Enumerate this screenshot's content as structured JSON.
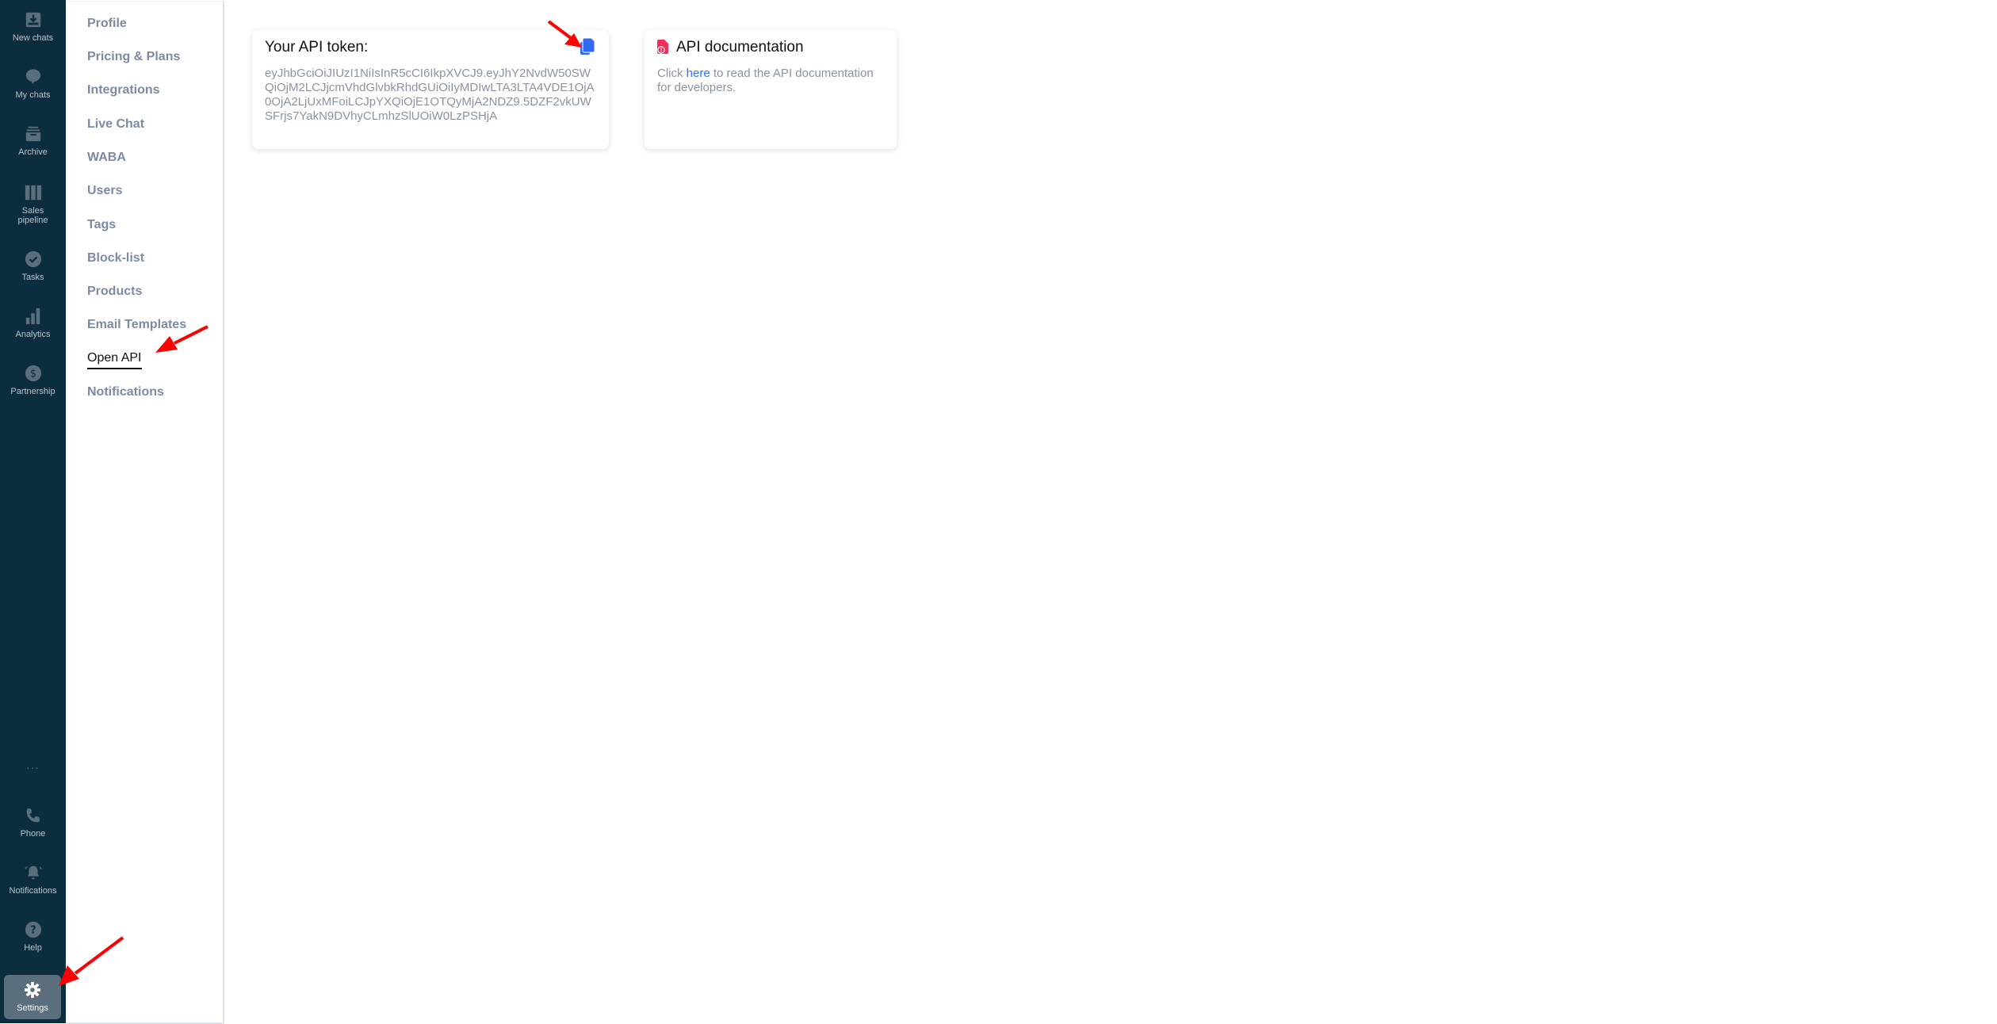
{
  "sidebar": {
    "items": [
      {
        "label": "New chats",
        "icon": "inbox-download-icon"
      },
      {
        "label": "My chats",
        "icon": "chat-bubble-icon"
      },
      {
        "label": "Archive",
        "icon": "archive-box-icon"
      },
      {
        "label": "Sales pipeline",
        "icon": "pipeline-columns-icon"
      },
      {
        "label": "Tasks",
        "icon": "check-circle-icon"
      },
      {
        "label": "Analytics",
        "icon": "bar-chart-icon"
      },
      {
        "label": "Partnership",
        "icon": "dollar-circle-icon"
      }
    ],
    "more": "···",
    "bottom_items": [
      {
        "label": "Phone",
        "icon": "phone-icon"
      },
      {
        "label": "Notifications",
        "icon": "bell-icon"
      },
      {
        "label": "Help",
        "icon": "help-circle-icon"
      },
      {
        "label": "Settings",
        "icon": "gear-icon",
        "active": true
      }
    ]
  },
  "settings_menu": {
    "items": [
      {
        "label": "Profile"
      },
      {
        "label": "Pricing & Plans"
      },
      {
        "label": "Integrations"
      },
      {
        "label": "Live Chat"
      },
      {
        "label": "WABA"
      },
      {
        "label": "Users"
      },
      {
        "label": "Tags"
      },
      {
        "label": "Block-list"
      },
      {
        "label": "Products"
      },
      {
        "label": "Email Templates"
      },
      {
        "label": "Open API",
        "active": true
      },
      {
        "label": "Notifications"
      }
    ]
  },
  "token_card": {
    "title": "Your API token:",
    "token": "eyJhbGciOiJIUzI1NiIsInR5cCI6IkpXVCJ9.eyJhY2NvdW50SWQiOjM2LCJjcmVhdGlvbkRhdGUiOiIyMDIwLTA3LTA4VDE1OjA0OjA2LjUxMFoiLCJpYXQiOjE1OTQyMjA2NDZ9.5DZF2vkUWSFrjs7YakN9DVhyCLmhzSlUOiW0LzPSHjA",
    "copy_icon": "copy-icon"
  },
  "doc_card": {
    "title": "API documentation",
    "icon": "document-alert-icon",
    "text_before": "Click ",
    "link_text": "here",
    "text_after": " to read the API documentation for developers."
  },
  "colors": {
    "sidebar_bg": "#0c2d3e",
    "active_nav_bg": "#5a6e7b",
    "copy_icon": "#2f6bf2",
    "doc_icon": "#f0305a",
    "link": "#3470f0",
    "annotation_arrow": "#ff0000"
  }
}
